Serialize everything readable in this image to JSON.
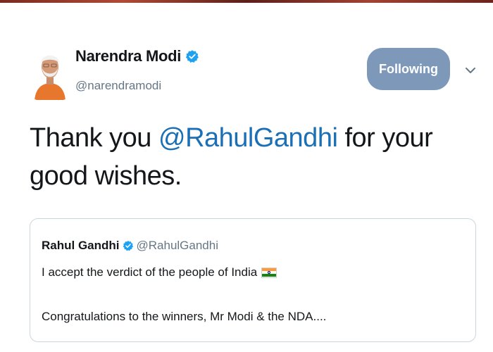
{
  "tweet": {
    "author_name": "Narendra Modi",
    "author_handle": "@narendramodi",
    "follow_label": "Following",
    "text_before": "Thank you ",
    "mention": "@RahulGandhi",
    "text_after": " for your good wishes.",
    "icons": {
      "verified": "verified-badge-icon",
      "menu": "chevron-down-icon",
      "avatar": "profile-photo"
    }
  },
  "quoted_tweet": {
    "author_name": "Rahul Gandhi",
    "author_handle": "@RahulGandhi",
    "line1": "I accept the verdict of the people of India",
    "line2": "Congratulations to the winners, Mr Modi & the NDA....",
    "icons": {
      "verified": "verified-badge-icon",
      "flag": "india-flag-emoji"
    }
  },
  "colors": {
    "follow_button": "#7e98ba",
    "mention": "#1b6fb5",
    "handle": "#657786",
    "verified": "#1da1f2"
  }
}
